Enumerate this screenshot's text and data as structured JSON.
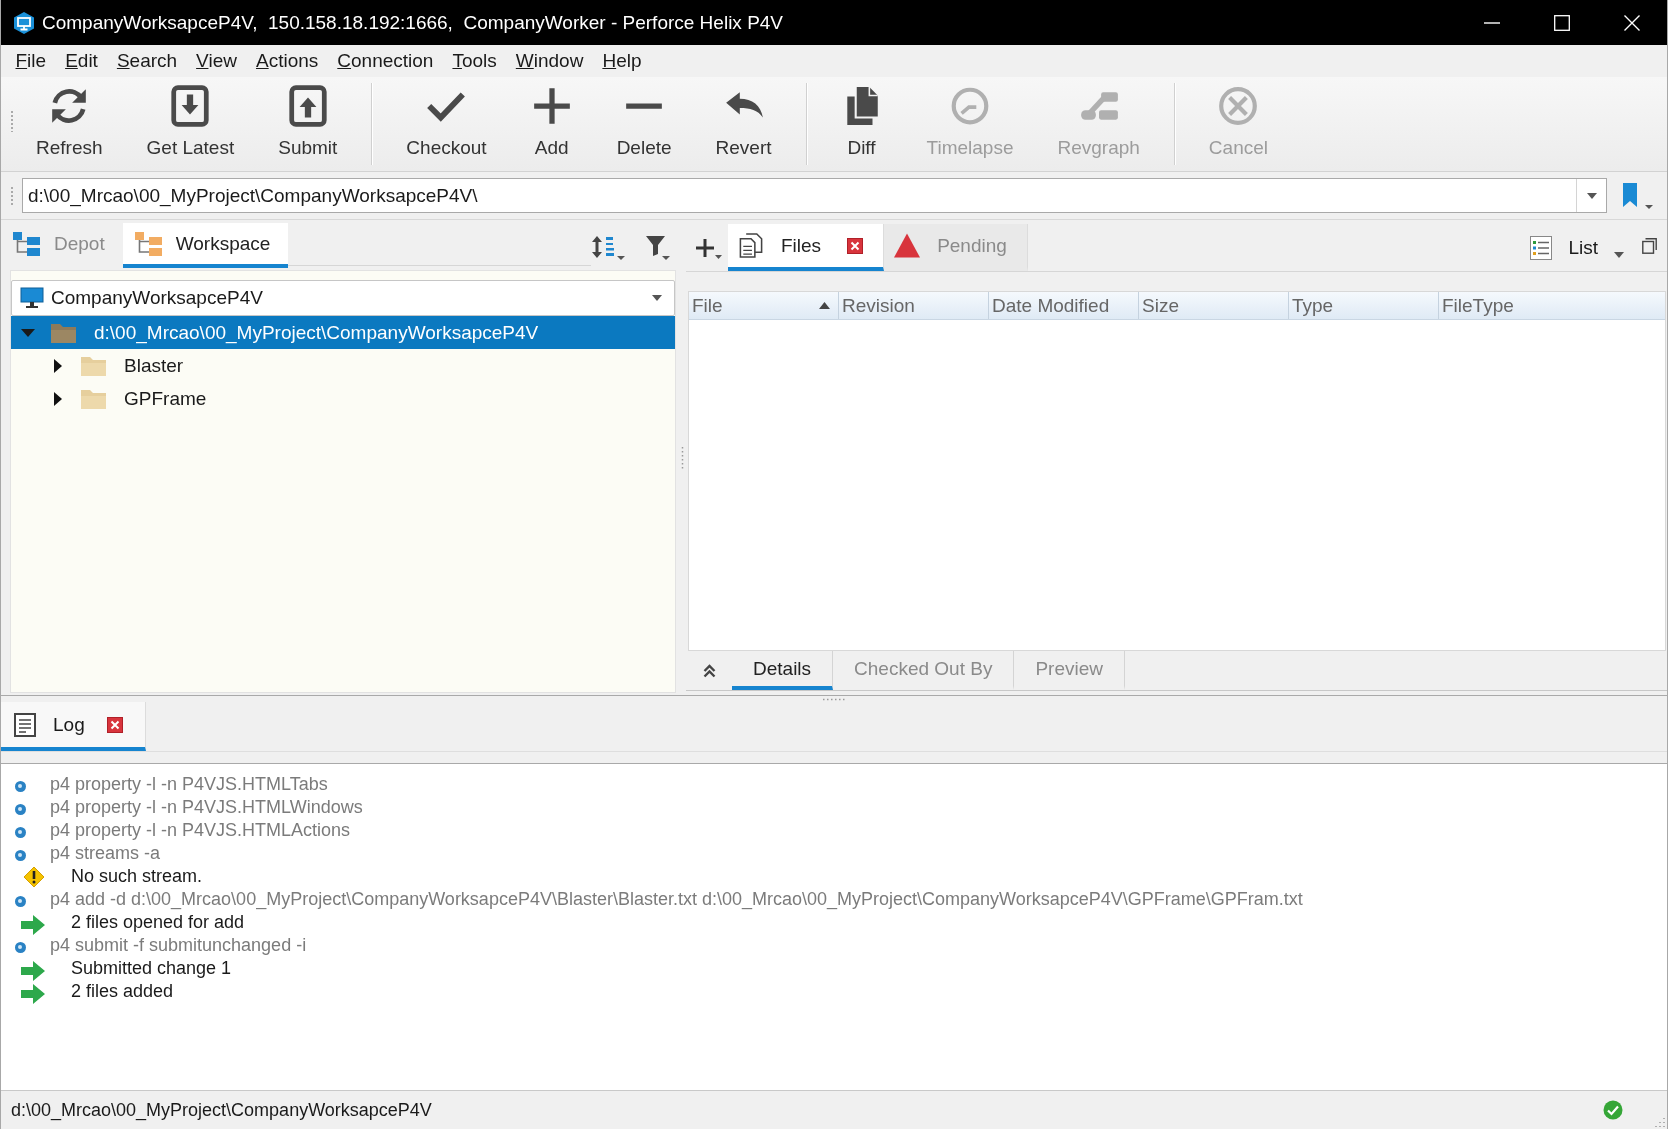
{
  "window": {
    "title": "CompanyWorksapceP4V,  150.158.18.192:1666,  CompanyWorker - Perforce Helix P4V"
  },
  "menu": [
    "File",
    "Edit",
    "Search",
    "View",
    "Actions",
    "Connection",
    "Tools",
    "Window",
    "Help"
  ],
  "toolbar": {
    "groups": [
      [
        {
          "label": "Refresh",
          "disabled": false
        },
        {
          "label": "Get Latest",
          "disabled": false
        },
        {
          "label": "Submit",
          "disabled": false
        }
      ],
      [
        {
          "label": "Checkout",
          "disabled": false
        },
        {
          "label": "Add",
          "disabled": false
        },
        {
          "label": "Delete",
          "disabled": false
        },
        {
          "label": "Revert",
          "disabled": false
        }
      ],
      [
        {
          "label": "Diff",
          "disabled": false
        },
        {
          "label": "Timelapse",
          "disabled": true
        },
        {
          "label": "Revgraph",
          "disabled": true
        }
      ],
      [
        {
          "label": "Cancel",
          "disabled": true
        }
      ]
    ]
  },
  "address_bar": {
    "value": "d:\\00_Mrcao\\00_MyProject\\CompanyWorksapceP4V\\"
  },
  "left_panel": {
    "tabs": [
      {
        "label": "Depot",
        "selected": false
      },
      {
        "label": "Workspace",
        "selected": true
      }
    ],
    "workspace_selector": {
      "value": "CompanyWorksapceP4V"
    },
    "tree": [
      {
        "label": "d:\\00_Mrcao\\00_MyProject\\CompanyWorksapceP4V",
        "expanded": true,
        "selected": true,
        "children": [
          {
            "label": "Blaster",
            "expanded": false,
            "selected": false
          },
          {
            "label": "GPFrame",
            "expanded": false,
            "selected": false
          }
        ]
      }
    ]
  },
  "right_panel": {
    "tabs": [
      {
        "label": "Files",
        "selected": true,
        "closable": true
      },
      {
        "label": "Pending",
        "selected": false,
        "closable": false
      }
    ],
    "view_selector": {
      "value": "List"
    },
    "table": {
      "columns": [
        {
          "label": "File",
          "sorted": true
        },
        {
          "label": "Revision",
          "sorted": false
        },
        {
          "label": "Date Modified",
          "sorted": false
        },
        {
          "label": "Size",
          "sorted": false
        },
        {
          "label": "Type",
          "sorted": false
        },
        {
          "label": "FileType",
          "sorted": false
        }
      ]
    },
    "detail_tabs": [
      {
        "label": "Details",
        "selected": true
      },
      {
        "label": "Checked Out By",
        "selected": false
      },
      {
        "label": "Preview",
        "selected": false
      }
    ]
  },
  "log_panel": {
    "tab": {
      "label": "Log",
      "selected": true,
      "closable": true
    },
    "lines": [
      {
        "kind": "command",
        "text": "p4 property -l -n P4VJS.HTMLTabs"
      },
      {
        "kind": "command",
        "text": "p4 property -l -n P4VJS.HTMLWindows"
      },
      {
        "kind": "command",
        "text": "p4 property -l -n P4VJS.HTMLActions"
      },
      {
        "kind": "command",
        "text": "p4 streams -a"
      },
      {
        "kind": "warning",
        "text": "No such stream."
      },
      {
        "kind": "command",
        "text": "p4 add -d d:\\00_Mrcao\\00_MyProject\\CompanyWorksapceP4V\\Blaster\\Blaster.txt d:\\00_Mrcao\\00_MyProject\\CompanyWorksapceP4V\\GPFrame\\GPFram.txt"
      },
      {
        "kind": "output",
        "text": "2 files opened for add"
      },
      {
        "kind": "command",
        "text": "p4 submit -f submitunchanged -i"
      },
      {
        "kind": "output",
        "text": "Submitted change 1"
      },
      {
        "kind": "output",
        "text": "2 files added"
      }
    ]
  },
  "status_bar": {
    "path": "d:\\00_Mrcao\\00_MyProject\\CompanyWorksapceP4V",
    "connected": true
  }
}
